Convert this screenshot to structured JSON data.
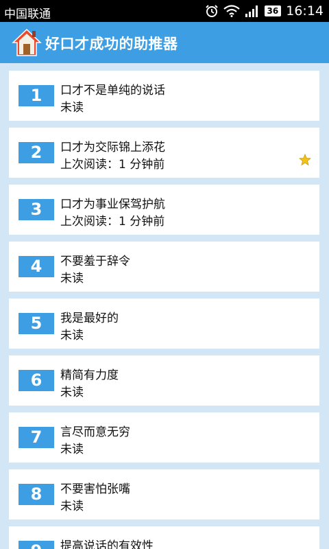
{
  "status_bar": {
    "carrier": "中国联通",
    "network_badge": "36",
    "time": "16:14",
    "icons": [
      "alarm-icon",
      "wifi-icon",
      "signal-icon"
    ]
  },
  "header": {
    "app_icon": "home-icon",
    "title": "好口才成功的助推器"
  },
  "colors": {
    "accent": "#3d9ee3",
    "background": "#d2e6f6",
    "card": "#ffffff",
    "star": "#f2c316"
  },
  "articles": [
    {
      "number": "1",
      "title": "口才不是单纯的说话",
      "status": "未读"
    },
    {
      "number": "2",
      "title": "口才为交际锦上添花",
      "status": "上次阅读：1 分钟前",
      "starred": true
    },
    {
      "number": "3",
      "title": "口才为事业保驾护航",
      "status": "上次阅读：1 分钟前"
    },
    {
      "number": "4",
      "title": "不要羞于辞令",
      "status": "未读"
    },
    {
      "number": "5",
      "title": "我是最好的",
      "status": "未读"
    },
    {
      "number": "6",
      "title": "精简有力度",
      "status": "未读"
    },
    {
      "number": "7",
      "title": "言尽而意无穷",
      "status": "未读"
    },
    {
      "number": "8",
      "title": "不要害怕张嘴",
      "status": "未读"
    },
    {
      "number": "9",
      "title": "提高说话的有效性",
      "status": ""
    }
  ]
}
